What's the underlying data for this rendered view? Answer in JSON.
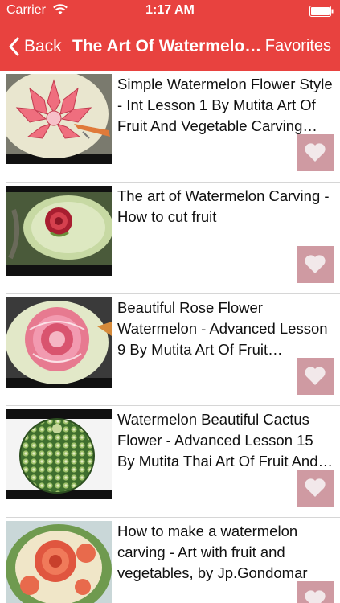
{
  "status_bar": {
    "carrier": "Carrier",
    "time": "1:17 AM"
  },
  "nav": {
    "back_label": "Back",
    "title": "The Art Of Watermelon Carving",
    "favorites_label": "Favorites"
  },
  "colors": {
    "accent": "#e8423f",
    "favorite_button": "#cf9aa2"
  },
  "videos": [
    {
      "title": "Simple Watermelon Flower Style - Int Lesson 1 By Mutita Art Of Fruit And Vegetable Carving Video",
      "thumbnail": "white-lotus-carving",
      "favorite_icon": "heart-icon"
    },
    {
      "title": "The art of Watermelon Carving - How to cut fruit",
      "thumbnail": "rose-in-watermelon-rind",
      "favorite_icon": "heart-icon"
    },
    {
      "title": "Beautiful Rose Flower Watermelon - Advanced Lesson 9 By Mutita Art Of Fruit Vegetable Carving",
      "thumbnail": "pink-rose-carving",
      "favorite_icon": "heart-icon"
    },
    {
      "title": "Watermelon Beautiful Cactus Flower - Advanced Lesson 15 By Mutita Thai Art Of Fruit And Vegetable Carving",
      "thumbnail": "cactus-pattern-watermelon",
      "favorite_icon": "heart-icon"
    },
    {
      "title": "How to make a watermelon carving - Art with fruit and vegetables, by Jp.Gondomar",
      "thumbnail": "red-flower-carving",
      "favorite_icon": "heart-icon"
    }
  ]
}
